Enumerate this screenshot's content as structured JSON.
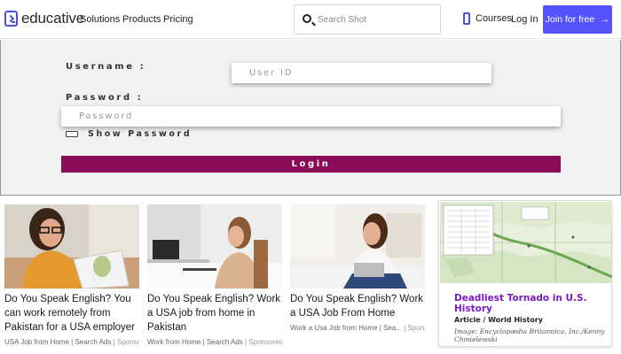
{
  "nav": {
    "logo_text": "educative",
    "links": [
      "Solutions",
      "Products",
      "Pricing"
    ],
    "search_placeholder": "Search Shot",
    "courses_label": "Courses",
    "login_label": "Log In",
    "join_label": "Join for free",
    "join_arrow": "→",
    "accent_color": "#5553ff"
  },
  "login_form": {
    "username_label": "Username :",
    "username_placeholder": "User ID",
    "password_label": "Password :",
    "password_placeholder": "Password",
    "show_password_label": "Show Password",
    "submit_label": "Login",
    "button_color": "#8a0b57"
  },
  "ads": [
    {
      "title": "Do You Speak English? You can work remotely from Pakistan for a USA employer",
      "source": "USA Job from Home | Search Ads",
      "sponsored": "| Sponsored"
    },
    {
      "title": "Do You Speak English? Work a USA job from home in Pakistan",
      "source": "Work from Home | Search Ads",
      "sponsored": "| Sponsored"
    },
    {
      "title": "Do You Speak English? Work a USA Job From Home",
      "source": "Work a Usa Job from Home | Sea...",
      "sponsored": "| Sponsored"
    }
  ],
  "article": {
    "title": "Deadliest Tornado in U.S. History",
    "category": "Article / World History",
    "credit": "Image: Encyclopædia Britannica, Inc./Kenny Chmielewski",
    "title_color": "#7a1ac0"
  }
}
